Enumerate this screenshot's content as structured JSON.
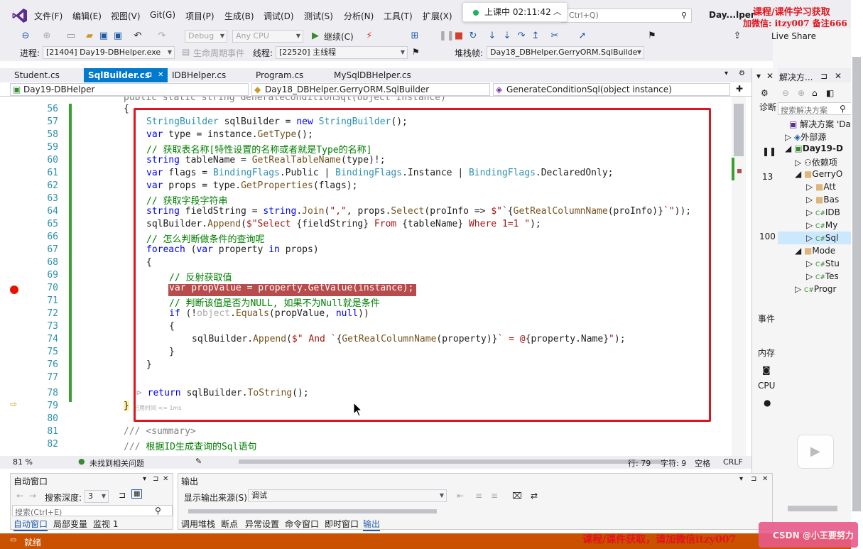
{
  "menu": {
    "items": [
      "文件(F)",
      "编辑(E)",
      "视图(V)",
      "Git(G)",
      "项目(P)",
      "生成(B)",
      "调试(D)",
      "测试(S)",
      "分析(N)",
      "工具(T)",
      "扩展(X)"
    ],
    "window_title": "Day...lper",
    "search_placeholder": "Ctrl+Q)",
    "timer": "上课中 02:11:42"
  },
  "toolbar": {
    "config": "Debug",
    "platform": "Any CPU",
    "continue_label": "继续(C)",
    "live_share": "Live Share"
  },
  "debugbar": {
    "process_label": "进程:",
    "process_value": "[21404] Day19-DBHelper.exe",
    "lifecycle_label": "生命周期事件",
    "thread_label": "线程:",
    "thread_value": "[22520] 主线程",
    "stack_label": "堆栈帧:",
    "stack_value": "Day18_DBHelper.GerryORM.SqlBuilde"
  },
  "tabs": [
    {
      "label": "Student.cs"
    },
    {
      "label": "SqlBuilder.cs"
    },
    {
      "label": "IDBHelper.cs"
    },
    {
      "label": "Program.cs"
    },
    {
      "label": "MySqlDBHelper.cs"
    }
  ],
  "tab_pin": "⊐",
  "navbar": {
    "project": "Day19-DBHelper",
    "class": "Day18_DBHelper.GerryORM.SqlBuilder",
    "member": "GenerateConditionSql(object instance)"
  },
  "code": {
    "top_partial": "public static string GenerateConditionSql(object instance)",
    "line_numbers": [
      "56",
      "57",
      "58",
      "59",
      "60",
      "61",
      "62",
      "63",
      "64",
      "65",
      "66",
      "67",
      "68",
      "69",
      "70",
      "71",
      "72",
      "73",
      "74",
      "75",
      "76",
      "77",
      "78",
      "79",
      "80",
      "81",
      "82"
    ],
    "inline_hint": "已用时间 <= 1ms"
  },
  "status_editor": {
    "zoom": "81 %",
    "issues": "未找到相关问题",
    "line": "行: 79",
    "char": "字符: 9",
    "space": "空格",
    "eol": "CRLF"
  },
  "solution": {
    "title": "解决方...",
    "search": "搜索解决方案",
    "items": [
      "解决方案 'Da",
      "外部源",
      "Day19-D",
      "依赖项",
      "GerryO",
      "Att",
      "Bas",
      "IDB",
      "My",
      "Sql",
      "Mode",
      "Stu",
      "Tes",
      "Progr"
    ],
    "side_labels": [
      "诊断",
      "13",
      "100",
      "事件",
      "内存",
      "CPU"
    ]
  },
  "autos": {
    "title": "自动窗口",
    "depth_label": "搜索深度:",
    "depth_value": "3",
    "search": "搜索(Ctrl+E)",
    "tabs": [
      "自动窗口",
      "局部变量",
      "监视 1"
    ]
  },
  "output": {
    "title": "输出",
    "source_label": "显示输出来源(S):",
    "source_value": "调试",
    "tabs": [
      "调用堆栈",
      "断点",
      "异常设置",
      "命令窗口",
      "即时窗口",
      "输出"
    ]
  },
  "status": {
    "text": "就绪"
  },
  "watermarks": {
    "top1": "课程/课件学习获取",
    "top2": "加微信: itzy007  备注666",
    "bottom": "课程/课件获取，请加微信itzy007",
    "csdn": "CSDN @小王要努力"
  }
}
